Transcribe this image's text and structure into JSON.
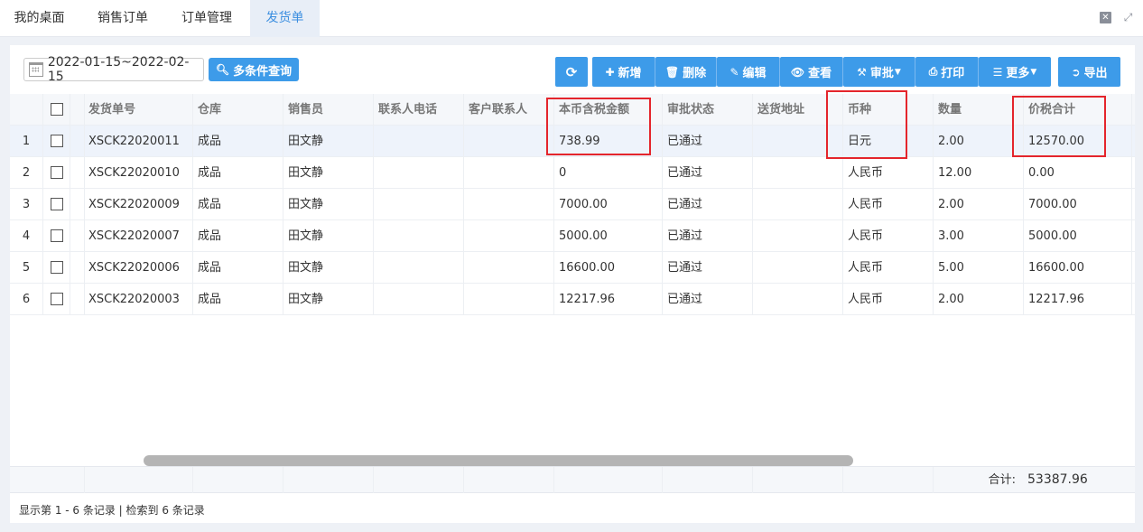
{
  "tabs": [
    "我的桌面",
    "销售订单",
    "订单管理",
    "发货单"
  ],
  "toolbar": {
    "date_range": "2022-01-15~2022-02-15",
    "query_label": "多条件查询",
    "add_label": "新增",
    "delete_label": "删除",
    "edit_label": "编辑",
    "view_label": "查看",
    "audit_label": "审批",
    "print_label": "打印",
    "more_label": "更多",
    "export_label": "导出"
  },
  "columns": [
    "发货单号",
    "仓库",
    "销售员",
    "联系人电话",
    "客户联系人",
    "本币含税金额",
    "审批状态",
    "送货地址",
    "币种",
    "数量",
    "价税合计"
  ],
  "rows": [
    {
      "no": "1",
      "code": "XSCK22020011",
      "warehouse": "成品",
      "sales": "田文静",
      "phone": "",
      "contact": "",
      "amount": "738.99",
      "status": "已通过",
      "address": "",
      "currency": "日元",
      "qty": "2.00",
      "total": "12570.00"
    },
    {
      "no": "2",
      "code": "XSCK22020010",
      "warehouse": "成品",
      "sales": "田文静",
      "phone": "",
      "contact": "",
      "amount": "0",
      "status": "已通过",
      "address": "",
      "currency": "人民币",
      "qty": "12.00",
      "total": "0.00"
    },
    {
      "no": "3",
      "code": "XSCK22020009",
      "warehouse": "成品",
      "sales": "田文静",
      "phone": "",
      "contact": "",
      "amount": "7000.00",
      "status": "已通过",
      "address": "",
      "currency": "人民币",
      "qty": "2.00",
      "total": "7000.00"
    },
    {
      "no": "4",
      "code": "XSCK22020007",
      "warehouse": "成品",
      "sales": "田文静",
      "phone": "",
      "contact": "",
      "amount": "5000.00",
      "status": "已通过",
      "address": "",
      "currency": "人民币",
      "qty": "3.00",
      "total": "5000.00"
    },
    {
      "no": "5",
      "code": "XSCK22020006",
      "warehouse": "成品",
      "sales": "田文静",
      "phone": "",
      "contact": "",
      "amount": "16600.00",
      "status": "已通过",
      "address": "",
      "currency": "人民币",
      "qty": "5.00",
      "total": "16600.00"
    },
    {
      "no": "6",
      "code": "XSCK22020003",
      "warehouse": "成品",
      "sales": "田文静",
      "phone": "",
      "contact": "",
      "amount": "12217.96",
      "status": "已通过",
      "address": "",
      "currency": "人民币",
      "qty": "2.00",
      "total": "12217.96"
    }
  ],
  "summary": {
    "label": "合计:",
    "value": "53387.96"
  },
  "status_bar": "显示第 1 - 6 条记录 | 检索到 6 条记录",
  "colors": {
    "accent": "#3d9be9",
    "highlight": "#e4252c",
    "active_tab": "#3d8fe0"
  }
}
